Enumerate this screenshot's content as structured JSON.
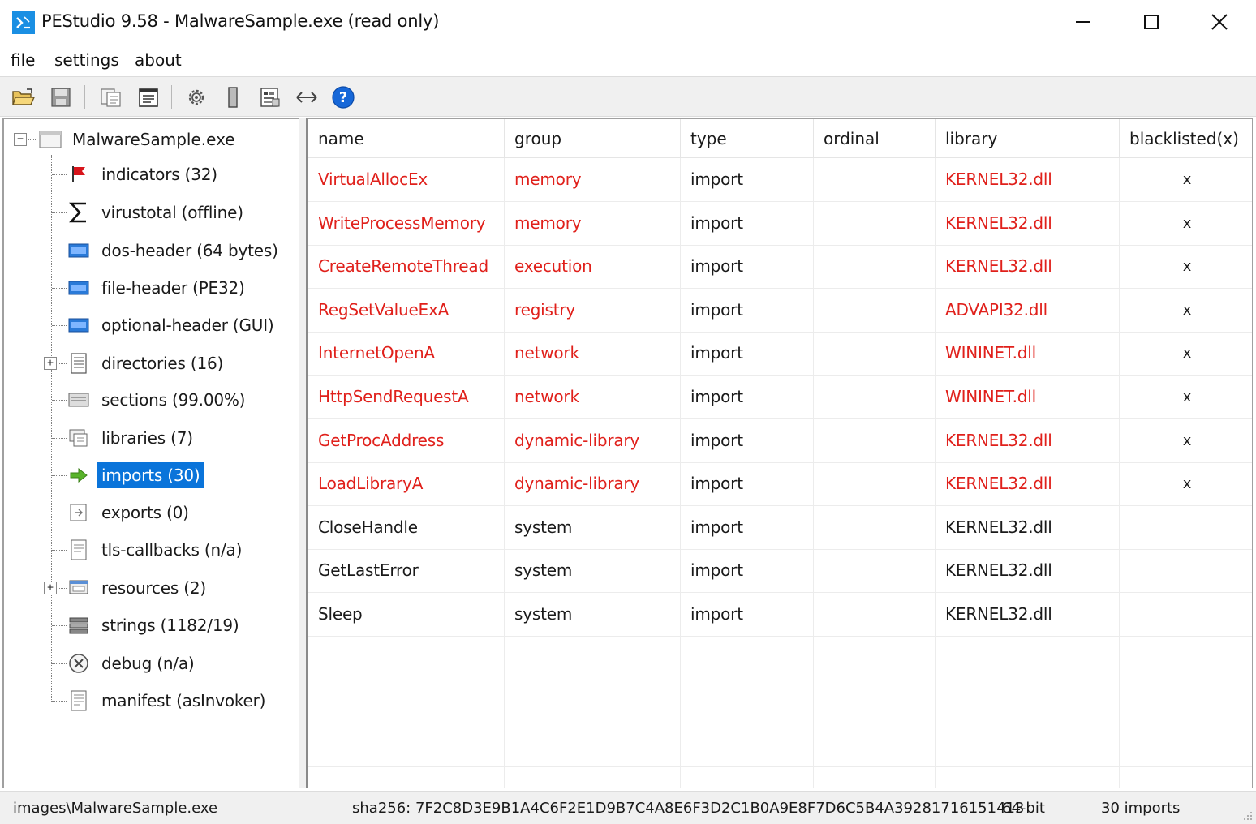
{
  "window": {
    "title": "PEStudio 9.58 - MalwareSample.exe (read only)"
  },
  "menu": {
    "items": [
      "file",
      "settings",
      "about"
    ]
  },
  "toolbar": {
    "buttons": [
      "open-folder-icon",
      "save-icon",
      "copy-icon",
      "properties-icon",
      "settings-icon",
      "bookmark-icon",
      "hex-view-icon",
      "compare-arrows-icon",
      "help-icon"
    ]
  },
  "tree": {
    "root": "MalwareSample.exe",
    "items": [
      {
        "label": "indicators (32)",
        "icon": "flag-icon"
      },
      {
        "label": "virustotal (offline)",
        "icon": "sigma-icon"
      },
      {
        "label": "dos-header (64 bytes)",
        "icon": "header-icon"
      },
      {
        "label": "file-header (PE32)",
        "icon": "header-icon"
      },
      {
        "label": "optional-header (GUI)",
        "icon": "header-icon"
      },
      {
        "label": "directories (16)",
        "icon": "list-icon"
      },
      {
        "label": "sections (99.00%)",
        "icon": "sections-icon"
      },
      {
        "label": "libraries (7)",
        "icon": "library-icon"
      },
      {
        "label": "imports (30)",
        "icon": "arrow-right-icon"
      },
      {
        "label": "exports (0)",
        "icon": "export-icon"
      },
      {
        "label": "tls-callbacks (n/a)",
        "icon": "document-icon"
      },
      {
        "label": "resources (2)",
        "icon": "resources-icon"
      },
      {
        "label": "strings (1182/19)",
        "icon": "strings-icon"
      },
      {
        "label": "debug (n/a)",
        "icon": "debug-icon"
      },
      {
        "label": "manifest (asInvoker)",
        "icon": "manifest-icon"
      }
    ]
  },
  "table": {
    "columns": [
      "name",
      "group",
      "type",
      "ordinal",
      "library",
      "blacklisted(x)"
    ],
    "rows": [
      {
        "name": "VirtualAllocEx",
        "group": "memory",
        "type": "import",
        "ordinal": "",
        "library": "KERNEL32.dll",
        "blacklisted": "x",
        "flagged": true
      },
      {
        "name": "WriteProcessMemory",
        "group": "memory",
        "type": "import",
        "ordinal": "",
        "library": "KERNEL32.dll",
        "blacklisted": "x",
        "flagged": true
      },
      {
        "name": "CreateRemoteThread",
        "group": "execution",
        "type": "import",
        "ordinal": "",
        "library": "KERNEL32.dll",
        "blacklisted": "x",
        "flagged": true
      },
      {
        "name": "RegSetValueExA",
        "group": "registry",
        "type": "import",
        "ordinal": "",
        "library": "ADVAPI32.dll",
        "blacklisted": "x",
        "flagged": true
      },
      {
        "name": "InternetOpenA",
        "group": "network",
        "type": "import",
        "ordinal": "",
        "library": "WININET.dll",
        "blacklisted": "x",
        "flagged": true
      },
      {
        "name": "HttpSendRequestA",
        "group": "network",
        "type": "import",
        "ordinal": "",
        "library": "WININET.dll",
        "blacklisted": "x",
        "flagged": true
      },
      {
        "name": "GetProcAddress",
        "group": "dynamic-library",
        "type": "import",
        "ordinal": "",
        "library": "KERNEL32.dll",
        "blacklisted": "x",
        "flagged": true
      },
      {
        "name": "LoadLibraryA",
        "group": "dynamic-library",
        "type": "import",
        "ordinal": "",
        "library": "KERNEL32.dll",
        "blacklisted": "x",
        "flagged": true
      },
      {
        "name": "CloseHandle",
        "group": "system",
        "type": "import",
        "ordinal": "",
        "library": "KERNEL32.dll",
        "blacklisted": "",
        "flagged": false
      },
      {
        "name": "GetLastError",
        "group": "system",
        "type": "import",
        "ordinal": "",
        "library": "KERNEL32.dll",
        "blacklisted": "",
        "flagged": false
      },
      {
        "name": "Sleep",
        "group": "system",
        "type": "import",
        "ordinal": "",
        "library": "KERNEL32.dll",
        "blacklisted": "",
        "flagged": false
      }
    ]
  },
  "status": {
    "path": "images\\MalwareSample.exe",
    "hash": "sha256: 7F2C8D3E9B1A4C6F2E1D9B7C4A8E6F3D2C1B0A9E8F7D6C5B4A39281716151413",
    "arch": "64-bit",
    "count": "30 imports"
  },
  "colors": {
    "accent": "#0a74da",
    "flagged_text": "#e0201b",
    "app_icon": "#1a8fe3"
  }
}
